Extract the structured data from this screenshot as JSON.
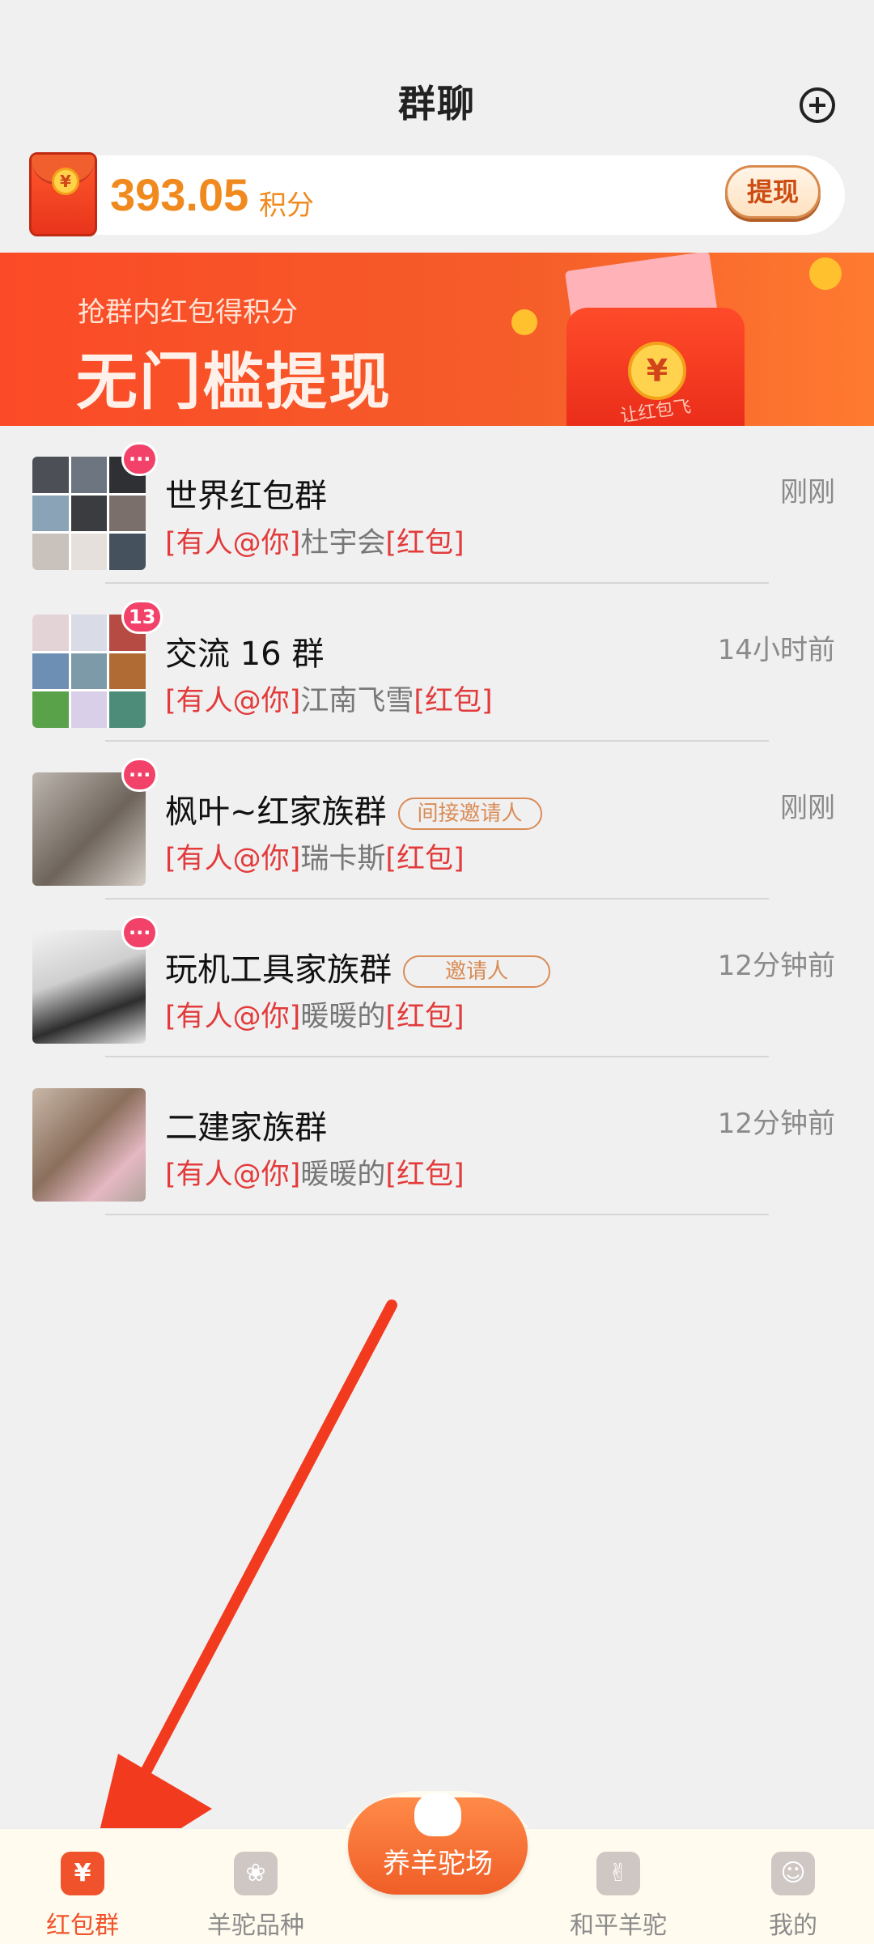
{
  "header": {
    "title": "群聊"
  },
  "points": {
    "value": "393.05",
    "unit": "积分",
    "withdraw_label": "提现"
  },
  "banner": {
    "subtitle": "抢群内红包得积分",
    "headline": "无门槛提现",
    "note_text": "让红包飞"
  },
  "chats": [
    {
      "name": "世界红包群",
      "tag": "",
      "time": "刚刚",
      "badge": "···",
      "preview_mention": "[有人@你]",
      "preview_sender": "杜宇会",
      "preview_type": "[红包]"
    },
    {
      "name": "交流 16 群",
      "tag": "",
      "time": "14小时前",
      "badge": "13",
      "preview_mention": "[有人@你]",
      "preview_sender": "江南飞雪",
      "preview_type": "[红包]"
    },
    {
      "name": "枫叶~红家族群",
      "tag": "间接邀请人",
      "time": "刚刚",
      "badge": "···",
      "preview_mention": "[有人@你]",
      "preview_sender": "瑞卡斯",
      "preview_type": "[红包]"
    },
    {
      "name": "玩机工具家族群",
      "tag": "邀请人",
      "time": "12分钟前",
      "badge": "···",
      "preview_mention": "[有人@你]",
      "preview_sender": "暖暖的",
      "preview_type": "[红包]"
    },
    {
      "name": "二建家族群",
      "tag": "",
      "time": "12分钟前",
      "badge": "",
      "preview_mention": "[有人@你]",
      "preview_sender": "暖暖的",
      "preview_type": "[红包]"
    }
  ],
  "tabbar": {
    "tabs": [
      {
        "label": "红包群",
        "icon": "red-envelope-icon",
        "active": true
      },
      {
        "label": "羊驼品种",
        "icon": "breeds-icon",
        "active": false
      },
      {
        "label": "养羊驼场",
        "icon": "alpaca-mascot-icon",
        "active": false
      },
      {
        "label": "和平羊驼",
        "icon": "peace-hand-icon",
        "active": false
      },
      {
        "label": "我的",
        "icon": "profile-icon",
        "active": false
      }
    ]
  },
  "colors": {
    "accent": "#f0532b",
    "badge": "#f2426a",
    "mention": "#e23b3b",
    "arrow": "#f23a1f"
  }
}
